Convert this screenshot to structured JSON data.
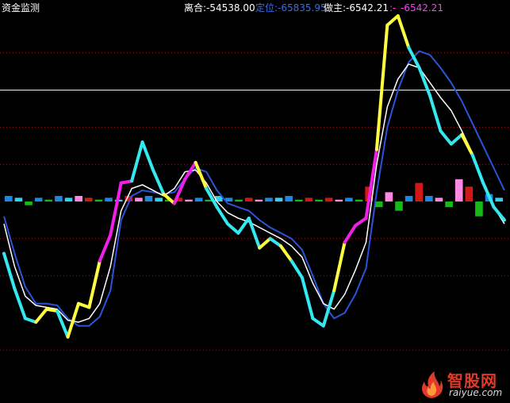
{
  "header": {
    "indicator_name": "资金监测",
    "lihe": "离合:-54538.00",
    "dingwei": "定位:-65835.95",
    "zuozhu": "做主:-6542.21",
    "extra": ":-",
    "extra_value": "-6542.21"
  },
  "colors": {
    "background": "#000000",
    "label_white": "#ffffff",
    "dingwei_blue": "#3b6ce0",
    "zuozhu_magenta": "#ff3cff",
    "line_white": "#ffffff",
    "line_blue": "#2b55d8",
    "seg_cyan": "#33e8f0",
    "seg_yellow": "#ffff40",
    "seg_magenta": "#f020e8",
    "bar_red": "#d01818",
    "bar_pink": "#ff88e0",
    "bar_green": "#18b818",
    "bar_blue": "#1e88e0",
    "bar_cyan": "#30d0f0",
    "grid_red": "#a01818",
    "ref_white": "#ffffff"
  },
  "watermark": {
    "brand_cn": "智股网",
    "brand_en": "raiyue.com",
    "logo_icon": "flame-icon"
  },
  "chart_data": {
    "type": "line",
    "title": "资金监测",
    "ylim": [
      -100,
      100
    ],
    "grid": true,
    "reference_line": 60,
    "x": [
      0,
      1,
      2,
      3,
      4,
      5,
      6,
      7,
      8,
      9,
      10,
      11,
      12,
      13,
      14,
      15,
      16,
      17,
      18,
      19,
      20,
      21,
      22,
      23,
      24,
      25,
      26,
      27,
      28,
      29,
      30,
      31,
      32,
      33,
      34,
      35,
      36,
      37,
      38,
      39,
      40,
      41,
      42,
      43,
      44,
      45,
      46,
      47,
      48,
      49,
      50,
      51,
      52,
      53,
      54,
      55,
      56,
      57,
      58,
      59,
      60,
      61,
      62,
      63
    ],
    "series": [
      {
        "name": "做主",
        "values": [
          -28,
          -47,
          -63,
          -65,
          -58,
          -59,
          -73,
          -55,
          -57,
          -32,
          -18,
          10,
          11,
          32,
          17,
          4,
          -1,
          12,
          21,
          7,
          -3,
          -12,
          -17,
          -9,
          -25,
          -20,
          -24,
          -32,
          -41,
          -63,
          -67,
          -48,
          -22,
          -13,
          -9,
          28,
          95,
          100,
          83,
          72,
          57,
          38,
          31,
          36,
          25,
          10,
          -3,
          -10
        ],
        "color_segments": [
          "cyan",
          "cyan",
          "cyan",
          "yellow",
          "yellow",
          "cyan",
          "yellow",
          "yellow",
          "yellow",
          "magenta",
          "magenta",
          "magenta",
          "cyan",
          "cyan",
          "cyan",
          "yellow",
          "magenta",
          "magenta",
          "yellow",
          "cyan",
          "cyan",
          "cyan",
          "cyan",
          "cyan",
          "yellow",
          "cyan",
          "yellow",
          "cyan",
          "cyan",
          "cyan",
          "cyan",
          "yellow",
          "magenta",
          "magenta",
          "magenta",
          "yellow",
          "yellow",
          "yellow",
          "cyan",
          "cyan",
          "cyan",
          "cyan",
          "cyan",
          "yellow",
          "cyan",
          "cyan",
          "cyan",
          "cyan"
        ]
      },
      {
        "name": "line_white",
        "values": [
          -12,
          -35,
          -51,
          -56,
          -57,
          -58,
          -64,
          -65,
          -63,
          -55,
          -35,
          -5,
          7,
          9,
          6,
          3,
          7,
          16,
          17,
          10,
          0,
          -6,
          -9,
          -11,
          -14,
          -17,
          -20,
          -24,
          -30,
          -44,
          -55,
          -58,
          -50,
          -37,
          -22,
          20,
          51,
          66,
          74,
          72,
          64,
          56,
          49,
          38,
          26,
          10,
          -3,
          -12
        ]
      },
      {
        "name": "line_blue",
        "values": [
          -8,
          -28,
          -46,
          -55,
          -55,
          -56,
          -63,
          -67,
          -67,
          -62,
          -48,
          -10,
          3,
          6,
          5,
          4,
          5,
          12,
          18,
          16,
          6,
          -1,
          -3,
          -5,
          -10,
          -14,
          -17,
          -20,
          -26,
          -40,
          -55,
          -63,
          -60,
          -50,
          -36,
          5,
          40,
          60,
          75,
          81,
          79,
          72,
          64,
          54,
          42,
          30,
          18,
          6
        ]
      }
    ],
    "bars": [
      {
        "v": 3,
        "color": "blue"
      },
      {
        "v": 2,
        "color": "cyan"
      },
      {
        "v": -2,
        "color": "green"
      },
      {
        "v": 2,
        "color": "blue"
      },
      {
        "v": 1,
        "color": "green"
      },
      {
        "v": 3,
        "color": "blue"
      },
      {
        "v": 2,
        "color": "cyan"
      },
      {
        "v": 3,
        "color": "pink"
      },
      {
        "v": 2,
        "color": "red"
      },
      {
        "v": 1,
        "color": "green"
      },
      {
        "v": 2,
        "color": "blue"
      },
      {
        "v": 1,
        "color": "cyan"
      },
      {
        "v": 3,
        "color": "red"
      },
      {
        "v": 2,
        "color": "pink"
      },
      {
        "v": 3,
        "color": "blue"
      },
      {
        "v": 2,
        "color": "cyan"
      },
      {
        "v": 1,
        "color": "green"
      },
      {
        "v": 2,
        "color": "red"
      },
      {
        "v": 1,
        "color": "pink"
      },
      {
        "v": 2,
        "color": "blue"
      },
      {
        "v": 1,
        "color": "green"
      },
      {
        "v": 3,
        "color": "cyan"
      },
      {
        "v": 2,
        "color": "blue"
      },
      {
        "v": 1,
        "color": "green"
      },
      {
        "v": 2,
        "color": "red"
      },
      {
        "v": 1,
        "color": "pink"
      },
      {
        "v": 2,
        "color": "blue"
      },
      {
        "v": 2,
        "color": "cyan"
      },
      {
        "v": 3,
        "color": "blue"
      },
      {
        "v": 1,
        "color": "green"
      },
      {
        "v": 2,
        "color": "red"
      },
      {
        "v": 1,
        "color": "green"
      },
      {
        "v": 2,
        "color": "red"
      },
      {
        "v": 1,
        "color": "pink"
      },
      {
        "v": 2,
        "color": "blue"
      },
      {
        "v": 1,
        "color": "green"
      },
      {
        "v": 8,
        "color": "red"
      },
      {
        "v": -3,
        "color": "green"
      },
      {
        "v": 5,
        "color": "pink"
      },
      {
        "v": -5,
        "color": "green"
      },
      {
        "v": 3,
        "color": "blue"
      },
      {
        "v": 10,
        "color": "red"
      },
      {
        "v": 3,
        "color": "blue"
      },
      {
        "v": 2,
        "color": "pink"
      },
      {
        "v": -3,
        "color": "green"
      },
      {
        "v": 12,
        "color": "pink"
      },
      {
        "v": 8,
        "color": "red"
      },
      {
        "v": -8,
        "color": "green"
      },
      {
        "v": 4,
        "color": "blue"
      },
      {
        "v": 2,
        "color": "cyan"
      }
    ]
  }
}
